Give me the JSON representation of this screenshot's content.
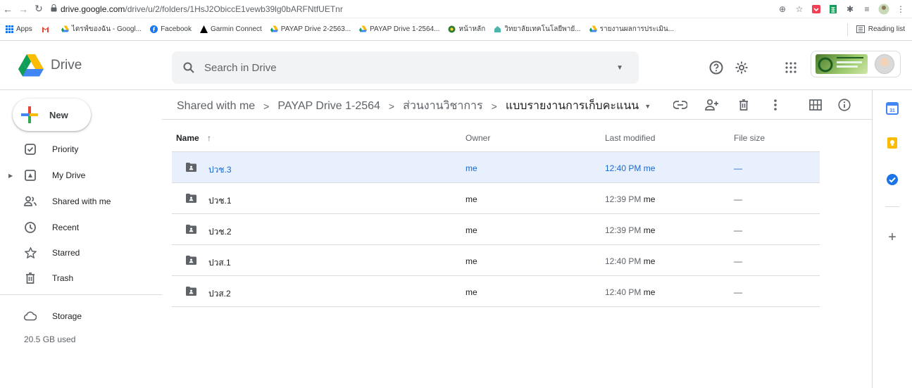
{
  "browser": {
    "url_host": "drive.google.com",
    "url_path": "/drive/u/2/folders/1HsJ2ObiccE1vewb39lg0bARFNtfUETnr",
    "bookmarks": [
      {
        "label": "Apps"
      },
      {
        "label": ""
      },
      {
        "label": "ไดรฟ์ของฉัน - Googl..."
      },
      {
        "label": "Facebook"
      },
      {
        "label": "Garmin Connect"
      },
      {
        "label": "PAYAP Drive 2-2563..."
      },
      {
        "label": "PAYAP Drive 1-2564..."
      },
      {
        "label": "หน้าหลัก"
      },
      {
        "label": "วิทยาลัยเทคโนโลยีพายั..."
      },
      {
        "label": "รายงานผลการประเมิน..."
      }
    ],
    "reading_list": "Reading list"
  },
  "header": {
    "app_name": "Drive",
    "search_placeholder": "Search in Drive"
  },
  "sidebar": {
    "new_label": "New",
    "items": [
      {
        "label": "Priority",
        "icon": "priority-icon"
      },
      {
        "label": "My Drive",
        "icon": "my-drive-icon"
      },
      {
        "label": "Shared with me",
        "icon": "shared-with-me-icon"
      },
      {
        "label": "Recent",
        "icon": "recent-icon"
      },
      {
        "label": "Starred",
        "icon": "star-icon"
      },
      {
        "label": "Trash",
        "icon": "trash-icon"
      },
      {
        "label": "Storage",
        "icon": "cloud-icon"
      }
    ],
    "storage_used": "20.5 GB used"
  },
  "breadcrumbs": [
    "Shared with me",
    "PAYAP Drive 1-2564",
    "ส่วนงานวิชาการ",
    "แบบรายงานการเก็บคะแนน"
  ],
  "columns": {
    "name": "Name",
    "owner": "Owner",
    "last_modified": "Last modified",
    "file_size": "File size"
  },
  "files": [
    {
      "name": "ปวช.3",
      "owner": "me",
      "modified_time": "12:40 PM",
      "modified_by": "me",
      "size": "—"
    },
    {
      "name": "ปวช.1",
      "owner": "me",
      "modified_time": "12:39 PM",
      "modified_by": "me",
      "size": "—"
    },
    {
      "name": "ปวช.2",
      "owner": "me",
      "modified_time": "12:39 PM",
      "modified_by": "me",
      "size": "—"
    },
    {
      "name": "ปวส.1",
      "owner": "me",
      "modified_time": "12:40 PM",
      "modified_by": "me",
      "size": "—"
    },
    {
      "name": "ปวส.2",
      "owner": "me",
      "modified_time": "12:40 PM",
      "modified_by": "me",
      "size": "—"
    }
  ],
  "selected_file_index": 0,
  "colors": {
    "selected_bg": "#e8f0fe",
    "selected_text": "#1967d2",
    "folder_shared": "#5f6368"
  }
}
